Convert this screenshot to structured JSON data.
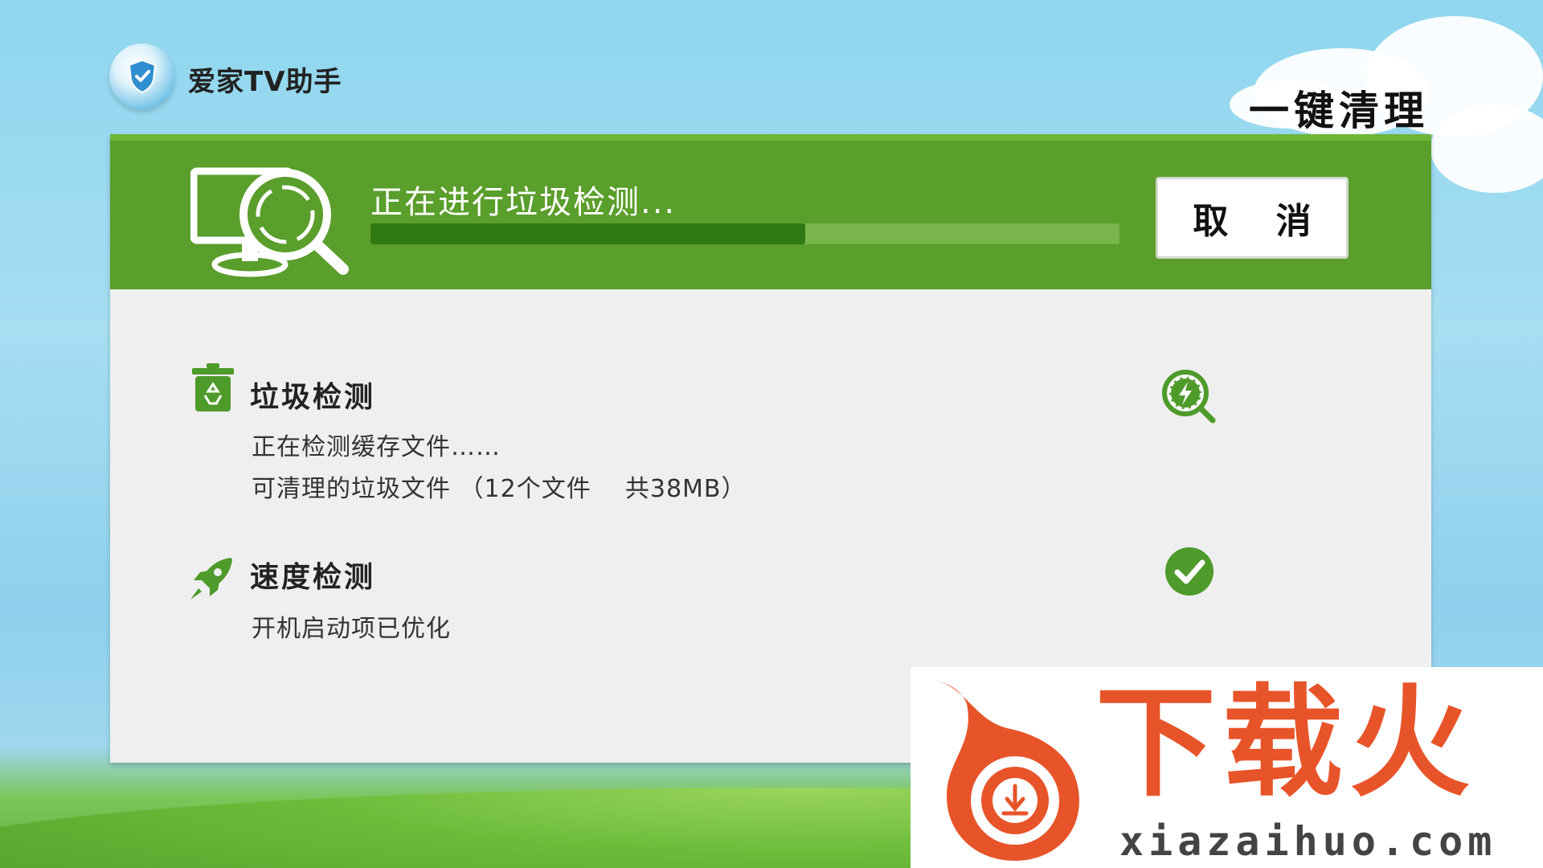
{
  "header": {
    "app_name": "爱家TV助手",
    "page_title": "一键清理"
  },
  "scan": {
    "status_text": "正在进行垃圾检测...",
    "progress": 0.58,
    "cancel_label": "取 消"
  },
  "items": [
    {
      "icon": "recycle-bin-icon",
      "title": "垃圾检测",
      "lines": [
        "正在检测缓存文件……",
        "可清理的垃圾文件 （12个文件    共38MB）"
      ],
      "status_icon": "scanning-magnifier-icon"
    },
    {
      "icon": "rocket-icon",
      "title": "速度检测",
      "lines": [
        "开机启动项已优化"
      ],
      "status_icon": "check-circle-icon"
    }
  ],
  "watermark": {
    "text": "下载火",
    "url": "xiazaihuo.com"
  },
  "colors": {
    "header_green": "#5a9e2b",
    "progress_fill": "#2f7a12",
    "progress_track": "#78b54a",
    "panel_bg": "#efefef",
    "icon_green": "#4e9a2a",
    "watermark_orange": "#e8542a"
  }
}
